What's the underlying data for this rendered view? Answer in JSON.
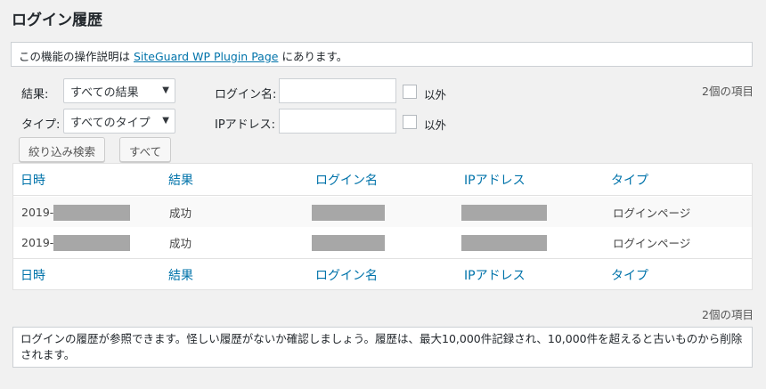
{
  "page": {
    "title": "ログイン履歴"
  },
  "notice": {
    "prefix": "この機能の操作説明は",
    "link": "SiteGuard WP Plugin Page",
    "suffix": "にあります。"
  },
  "filters": {
    "result_label": "結果:",
    "result_value": "すべての結果",
    "type_label": "タイプ:",
    "type_value": "すべてのタイプ",
    "login_name_label": "ログイン名:",
    "login_name_value": "",
    "ip_label": "IPアドレス:",
    "ip_value": "",
    "exclude_label": "以外",
    "filter_button": "絞り込み検索",
    "all_button": "すべて"
  },
  "count_text": "2個の項目",
  "table": {
    "columns": [
      "日時",
      "結果",
      "ログイン名",
      "IPアドレス",
      "タイプ"
    ],
    "rows": [
      {
        "datetime": "2019-",
        "result": "成功",
        "login_name": "",
        "ip": "",
        "type": "ログインページ"
      },
      {
        "datetime": "2019-",
        "result": "成功",
        "login_name": "",
        "ip": "",
        "type": "ログインページ"
      }
    ]
  },
  "description": "ログインの履歴が参照できます。怪しい履歴がないか確認しましょう。履歴は、最大10,000件記録され、10,000件を超えると古いものから削除されます。",
  "icons": {
    "dropdown": "chevron-down-icon",
    "checkbox": "checkbox-icon"
  },
  "colors": {
    "link": "#0073aa",
    "background": "#f1f1f1",
    "redaction": "#a7a7a7"
  }
}
